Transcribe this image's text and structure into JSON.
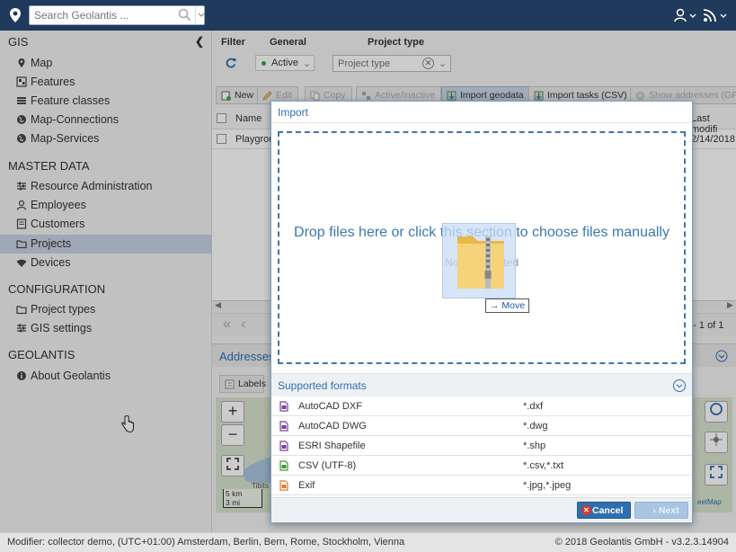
{
  "topbar": {
    "search_placeholder": "Search Geolantis ..."
  },
  "sidebar": {
    "sections": [
      {
        "title": "GIS",
        "items": [
          {
            "label": "Map",
            "icon": "map-pin-icon"
          },
          {
            "label": "Features",
            "icon": "features-icon"
          },
          {
            "label": "Feature classes",
            "icon": "list-icon"
          },
          {
            "label": "Map-Connections",
            "icon": "globe-icon"
          },
          {
            "label": "Map-Services",
            "icon": "globe-icon"
          }
        ]
      },
      {
        "title": "MASTER DATA",
        "items": [
          {
            "label": "Resource Administration",
            "icon": "sliders-icon"
          },
          {
            "label": "Employees",
            "icon": "user-icon"
          },
          {
            "label": "Customers",
            "icon": "id-card-icon"
          },
          {
            "label": "Projects",
            "icon": "folder-icon"
          },
          {
            "label": "Devices",
            "icon": "wifi-icon"
          }
        ]
      },
      {
        "title": "CONFIGURATION",
        "items": [
          {
            "label": "Project types",
            "icon": "folder-icon"
          },
          {
            "label": "GIS settings",
            "icon": "sliders-icon"
          }
        ]
      },
      {
        "title": "GEOLANTIS",
        "items": [
          {
            "label": "About Geolantis",
            "icon": "info-icon"
          }
        ]
      }
    ],
    "active_item": "Projects"
  },
  "filter": {
    "filter_label": "Filter",
    "general_label": "General",
    "project_type_label": "Project type",
    "status_value": "Active",
    "project_type_placeholder": "Project type"
  },
  "toolbar": {
    "new": "New",
    "edit": "Edit",
    "copy": "Copy",
    "active_inactive": "Active/inactive",
    "import_geodata": "Import geodata",
    "import_tasks": "Import tasks (CSV)",
    "show_addresses": "Show addresses (GPS"
  },
  "grid": {
    "col_name": "Name",
    "col_last_modified": "Last modifi",
    "row_name": "Playgrou",
    "row_date": "2/14/2018"
  },
  "pager": {
    "summary": "1 - 1 of 1"
  },
  "addresses": {
    "title": "Addresses",
    "labels_button": "Labels"
  },
  "map": {
    "zoom_in": "+",
    "zoom_out": "−",
    "scale_km": "5 km",
    "scale_mi": "3 mi",
    "place_label": "Tibits",
    "attribution": "eetMap"
  },
  "dialog": {
    "title": "Import",
    "drop_text": "Drop files here or click this section to choose files manually",
    "no_file": "No file selected",
    "drag_tooltip": "Move",
    "supported_formats_title": "Supported formats",
    "formats": [
      {
        "name": "AutoCAD DXF",
        "ext": "*.dxf",
        "color": "#7b3fa0"
      },
      {
        "name": "AutoCAD DWG",
        "ext": "*.dwg",
        "color": "#7b3fa0"
      },
      {
        "name": "ESRI Shapefile",
        "ext": "*.shp",
        "color": "#7b3fa0"
      },
      {
        "name": "CSV (UTF-8)",
        "ext": "*.csv,*.txt",
        "color": "#3a9a3a"
      },
      {
        "name": "Exif",
        "ext": "*.jpg,*.jpeg",
        "color": "#e07a2a"
      }
    ],
    "cancel_label": "Cancel",
    "next_label": "Next"
  },
  "footer": {
    "modifier": "Modifier: collector demo, (UTC+01:00) Amsterdam, Berlin, Bern, Rome, Stockholm, Vienna",
    "copyright": "© 2018 Geolantis GmbH - v3.2.3.14904"
  },
  "colors": {
    "topbar": "#1f3a5c",
    "accent": "#2f6fb0",
    "active_nav": "#c7d4e4"
  }
}
